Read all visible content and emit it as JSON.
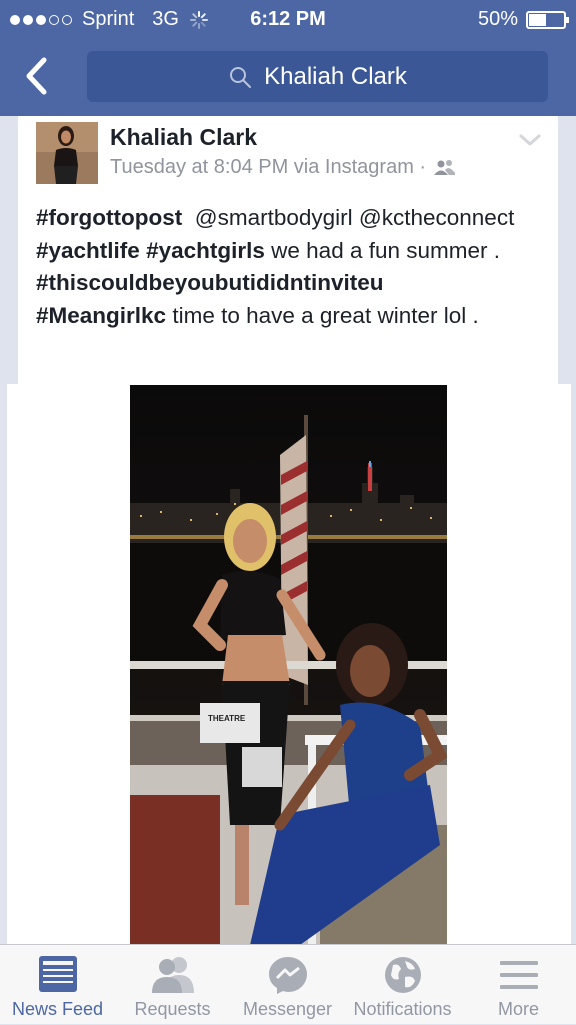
{
  "status_bar": {
    "carrier": "Sprint",
    "network": "3G",
    "time": "6:12 PM",
    "battery": "50%",
    "battery_level": 0.5,
    "signal_bars_filled": 3,
    "signal_bars_total": 5
  },
  "nav": {
    "back_icon": "chevron-left-icon",
    "search_icon": "search-icon",
    "search_text": "Khaliah Clark"
  },
  "post": {
    "author": "Khaliah Clark",
    "meta": "Tuesday at 8:04 PM via Instagram ·",
    "audience_icon": "friends-icon",
    "menu_icon": "chevron-down-icon",
    "text_parts": {
      "h1": "#forgottopost",
      "m1": "@smartbodygirl",
      "m2": "@kctheconnect",
      "h2": "#yachtlife",
      "h3": "#yachtgirls",
      "t1": "we had a fun summer .",
      "h4": "#thiscouldbeyoubutididntinviteu",
      "h5": "#Meangirlkc",
      "t2": "time to have a great winter lol ."
    },
    "photo_sign_text": "THEATRE"
  },
  "tab_bar": {
    "tabs": [
      {
        "label": "News Feed",
        "icon": "news-feed-icon",
        "active": true
      },
      {
        "label": "Requests",
        "icon": "friend-requests-icon",
        "active": false
      },
      {
        "label": "Messenger",
        "icon": "messenger-icon",
        "active": false
      },
      {
        "label": "Notifications",
        "icon": "globe-icon",
        "active": false
      },
      {
        "label": "More",
        "icon": "menu-lines-icon",
        "active": false
      }
    ]
  },
  "colors": {
    "brand_blue": "#4c67a4",
    "search_blue": "#3b5796",
    "active_tab": "#4c67a4",
    "inactive_tab": "#9197a3",
    "background": "#dfe3ee"
  }
}
